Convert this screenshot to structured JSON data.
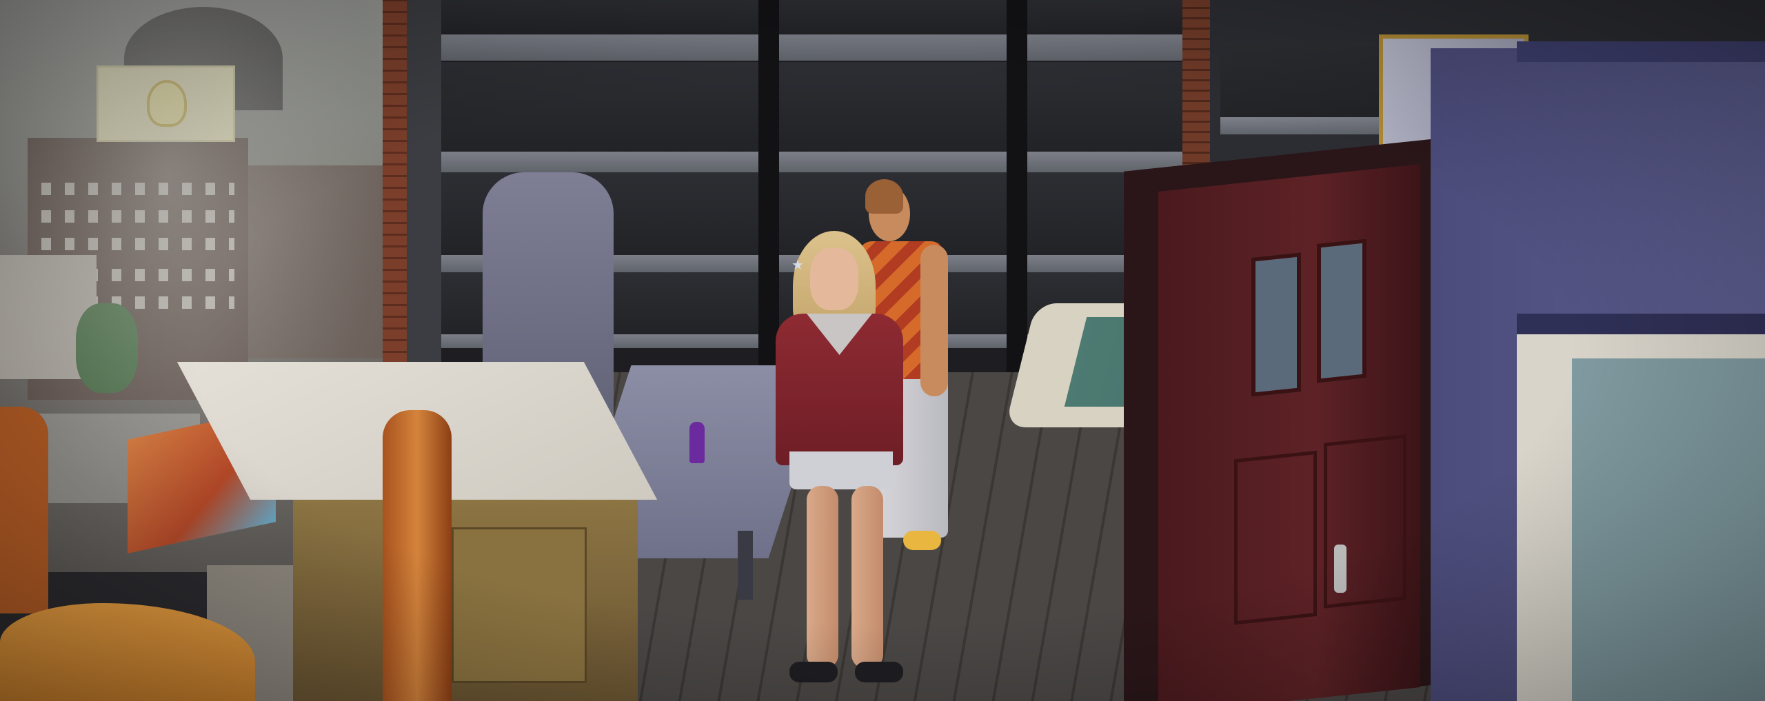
{
  "scene": {
    "description_type": "game-3d-view",
    "indicators": {
      "sparkle_icon": "sparkle-icon"
    }
  }
}
